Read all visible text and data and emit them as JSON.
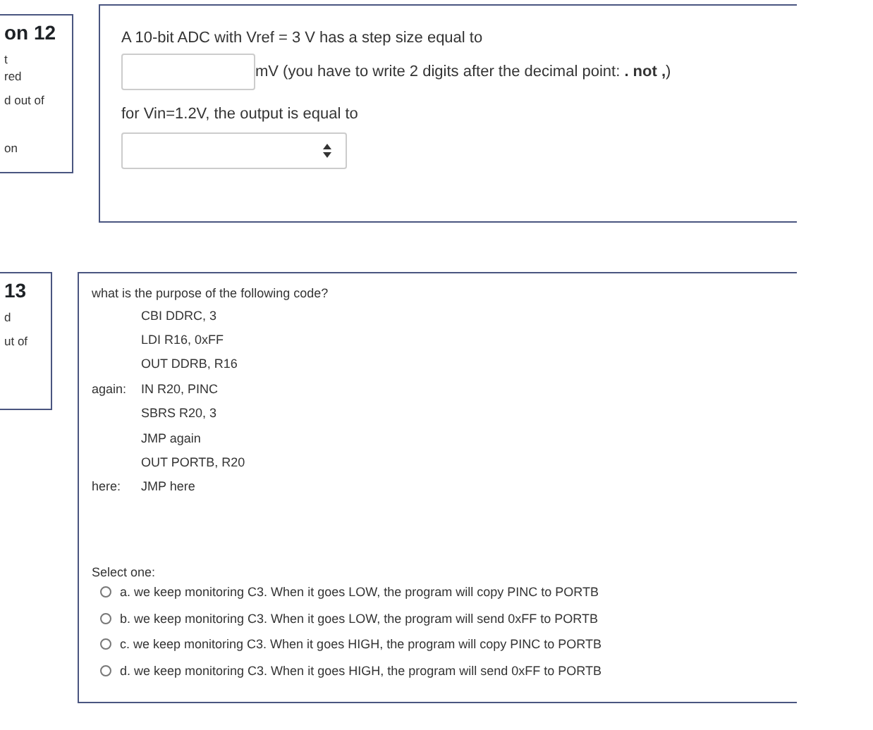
{
  "questions": [
    {
      "kind": "fill",
      "info": {
        "title_prefix": "on",
        "number": "12",
        "status": [
          "t",
          "red"
        ],
        "marks": [
          "d out of"
        ],
        "flag": [
          "on"
        ]
      },
      "prompt": "A 10-bit ADC with Vref = 3 V has a step size equal to",
      "unit_note": "mV (you have to write 2 digits after the decimal point: **. not ,**)",
      "prompt2": "for Vin=1.2V, the output is equal to"
    },
    {
      "kind": "multichoice",
      "info": {
        "number": "13",
        "status": [
          "d"
        ],
        "marks": [
          "ut of"
        ]
      },
      "prompt": "what is the purpose of the following code?",
      "code": [
        {
          "text": "CBI DDRC, 3"
        },
        {
          "text": "LDI R16, 0xFF"
        },
        {
          "text": "OUT DDRB, R16"
        },
        {
          "label": "again:",
          "text": "IN R20, PINC"
        },
        {
          "text": "SBRS R20, 3"
        },
        {
          "text": "JMP again"
        },
        {
          "text": "OUT PORTB, R20"
        },
        {
          "label": "here:",
          "text": "JMP here"
        }
      ],
      "select_label": "Select one:",
      "options": [
        {
          "text": "a. we keep monitoring C3. When it goes LOW, the program will copy PINC to PORTB",
          "selected": false
        },
        {
          "text": "b. we keep monitoring C3. When it goes LOW, the program will send 0xFF to PORTB",
          "selected": false
        },
        {
          "text": "c. we keep monitoring C3. When it goes HIGH, the program will copy PINC to PORTB",
          "selected": false
        },
        {
          "text": "d. we keep monitoring C3. When it goes HIGH, the program will send 0xFF to PORTB",
          "selected": false
        }
      ]
    }
  ]
}
